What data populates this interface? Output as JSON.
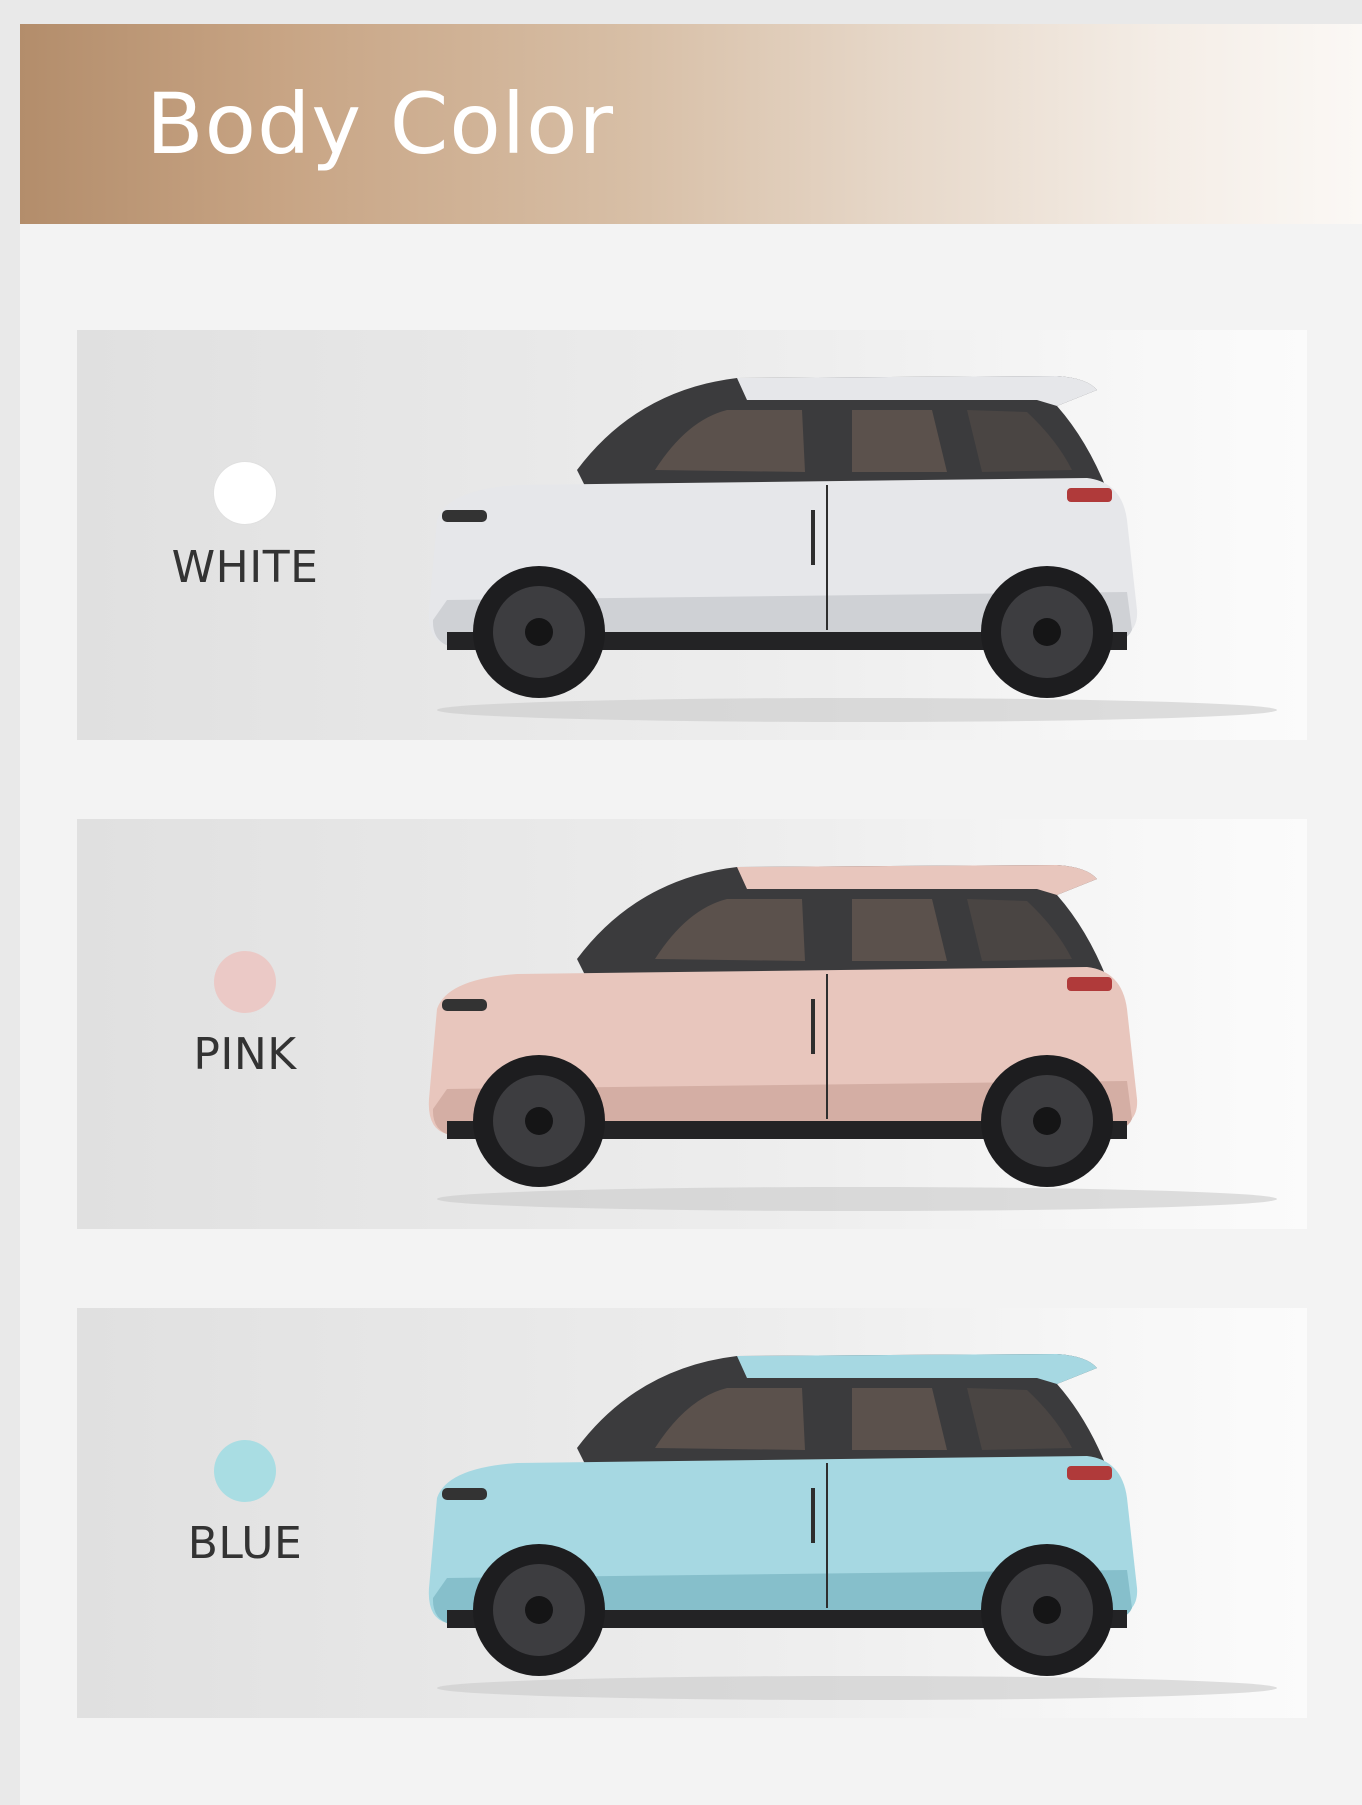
{
  "header": {
    "title": "Body Color"
  },
  "colors": [
    {
      "label": "WHITE",
      "swatch": "#ffffff",
      "body": "#e6e7ea",
      "shade": "#cfd1d5"
    },
    {
      "label": "PINK",
      "swatch": "#ebc9c6",
      "body": "#e8c6bd",
      "shade": "#d4aea4"
    },
    {
      "label": "BLUE",
      "swatch": "#a9dde3",
      "body": "#a6d8e2",
      "shade": "#86bfcb"
    }
  ],
  "icons": {
    "swatch": "color-dot-icon",
    "car": "car-side-icon"
  }
}
